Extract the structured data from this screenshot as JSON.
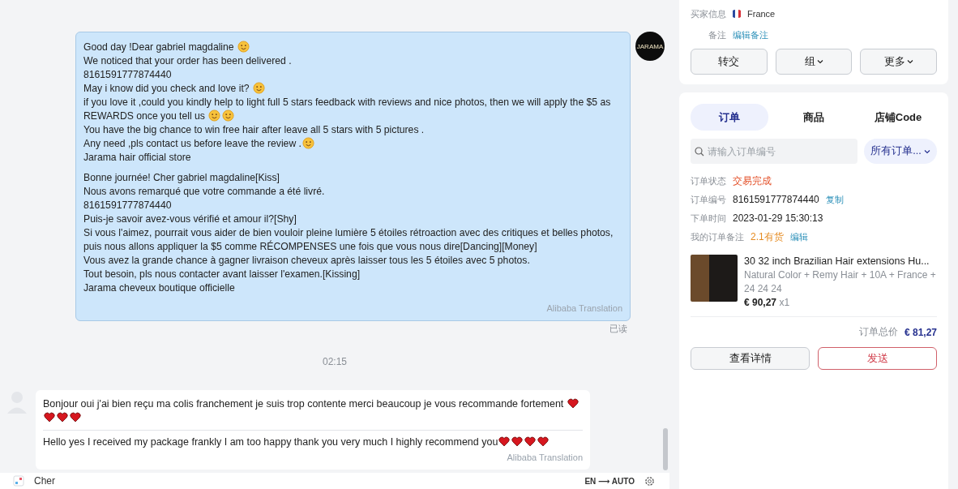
{
  "chat": {
    "outgoing": {
      "avatar_text": "JARAMA",
      "paragraphs": [
        [
          [
            {
              "kind": "text",
              "text": "Good day !Dear gabriel magdaline "
            },
            {
              "kind": "emoji"
            }
          ],
          [
            {
              "kind": "text",
              "text": "We noticed that your order has been delivered ."
            }
          ],
          [
            {
              "kind": "text",
              "text": "8161591777874440"
            }
          ],
          [
            {
              "kind": "text",
              "text": "May i know did you check and love it? "
            },
            {
              "kind": "emoji"
            }
          ],
          [
            {
              "kind": "text",
              "text": "if you love it ,could you kindly help to light full 5 stars feedback with  reviews and nice photos, then we will apply the $5 as REWARDS once you tell us "
            },
            {
              "kind": "emoji"
            },
            {
              "kind": "emoji"
            }
          ],
          [
            {
              "kind": "text",
              "text": "You have the big chance to win free hair after leave all 5 stars with 5 pictures ."
            }
          ],
          [
            {
              "kind": "text",
              "text": "Any need ,pls contact us before leave the review ."
            },
            {
              "kind": "emoji"
            }
          ],
          [
            {
              "kind": "text",
              "text": "Jarama hair official store"
            }
          ]
        ],
        [
          [
            {
              "kind": "text",
              "text": "Bonne journée! Cher gabriel magdaline[Kiss]"
            }
          ],
          [
            {
              "kind": "text",
              "text": "Nous avons remarqué que votre commande a été livré."
            }
          ],
          [
            {
              "kind": "text",
              "text": "8161591777874440"
            }
          ],
          [
            {
              "kind": "text",
              "text": "Puis-je savoir avez-vous vérifié et amour il?[Shy]"
            }
          ],
          [
            {
              "kind": "text",
              "text": "Si vous l'aimez, pourrait vous aider de bien vouloir pleine lumière 5 étoiles rétroaction avec des critiques et belles photos, puis nous allons appliquer la $5 comme RÉCOMPENSES une fois que vous nous dire[Dancing][Money]"
            }
          ],
          [
            {
              "kind": "text",
              "text": "Vous avez la grande chance à gagner livraison cheveux après laisser tous les 5 étoiles avec 5 photos."
            }
          ],
          [
            {
              "kind": "text",
              "text": "Tout besoin, pls nous contacter avant laisser l'examen.[Kissing]"
            }
          ],
          [
            {
              "kind": "text",
              "text": "Jarama cheveux boutique officielle"
            }
          ]
        ]
      ],
      "translation_note": "Alibaba Translation",
      "read_status": "已读"
    },
    "time": "02:15",
    "incoming": {
      "original": [
        {
          "kind": "text",
          "text": "Bonjour oui j'ai bien reçu ma colis franchement je suis trop contente merci beaucoup je vous recommande fortement "
        },
        {
          "kind": "heart"
        },
        {
          "kind": "heart"
        },
        {
          "kind": "heart"
        },
        {
          "kind": "heart"
        }
      ],
      "translated": [
        {
          "kind": "text",
          "text": "Hello yes I received my package frankly I am too happy thank you very much I highly recommend you"
        },
        {
          "kind": "heart"
        },
        {
          "kind": "heart"
        },
        {
          "kind": "heart"
        },
        {
          "kind": "heart"
        }
      ],
      "translation_note": "Alibaba Translation"
    },
    "input": {
      "value": "Cher",
      "language": "EN ⟶ AUTO"
    }
  },
  "buyer": {
    "info_label": "买家信息",
    "country": "France",
    "note_label": "备注",
    "note_link": "编辑备注",
    "buttons": [
      {
        "label": "转交",
        "dropdown": false
      },
      {
        "label": "组",
        "dropdown": true
      },
      {
        "label": "更多",
        "dropdown": true
      }
    ]
  },
  "orders": {
    "tabs": [
      {
        "label": "订单",
        "selected": true
      },
      {
        "label": "商品",
        "selected": false
      },
      {
        "label": "店铺Code",
        "selected": false
      }
    ],
    "search": {
      "placeholder": "请输入订单编号"
    },
    "filter": "所有订单...",
    "fields": [
      {
        "label": "订单状态",
        "value": "交易完成",
        "kind": "status"
      },
      {
        "label": "订单编号",
        "value": "8161591777874440",
        "kind": "plain",
        "link": "复制"
      },
      {
        "label": "下单时间",
        "value": "2023-01-29 15:30:13",
        "kind": "plain"
      },
      {
        "label": "我的订单备注",
        "value": "2.1有货",
        "kind": "note",
        "link": "编辑"
      }
    ],
    "product": {
      "title": "30 32 inch Brazilian Hair extensions Hu...",
      "variant": "Natural Color + Remy Hair + 10A + France + 24 24 24",
      "price": "€ 90,27",
      "quantity": "x1"
    },
    "total_label": "订单总价",
    "total": "€ 81,27",
    "actions": [
      {
        "label": "查看详情",
        "kind": "secondary"
      },
      {
        "label": "发送",
        "kind": "primary"
      }
    ]
  }
}
